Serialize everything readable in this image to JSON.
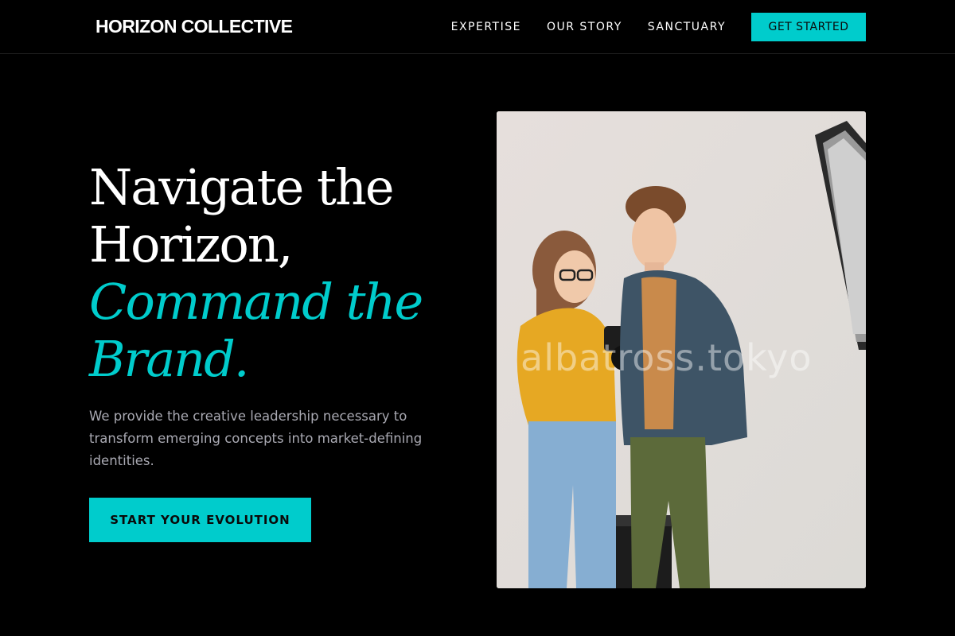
{
  "nav": {
    "brand": "HORIZON COLLECTIVE",
    "links": [
      "EXPERTISE",
      "OUR STORY",
      "SANCTUARY"
    ],
    "cta": "GET STARTED"
  },
  "hero": {
    "headline_line1": "Navigate the",
    "headline_line2": "Horizon,",
    "headline_accent_line1": "Command the",
    "headline_accent_line2": "Brand.",
    "lead": "We provide the creative leadership necessary to transform emerging concepts into market-defining identities.",
    "cta": "START YOUR EVOLUTION"
  },
  "photo": {
    "watermark": "albatross.tokyo",
    "subject": "two-people-looking-at-camera-photo"
  },
  "colors": {
    "background": "#000000",
    "accent": "#00cccc",
    "text": "#ffffff",
    "muted_text": "#a9a9b2"
  }
}
